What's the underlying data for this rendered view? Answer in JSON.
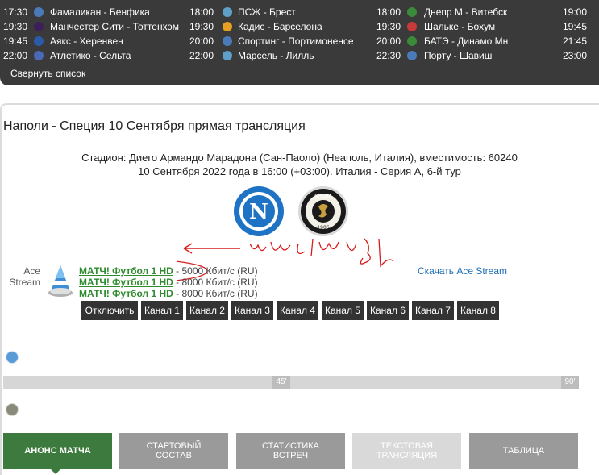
{
  "schedule": {
    "rows": [
      [
        {
          "time": "17:30",
          "teams": "Фамаликан - Бенфика",
          "icon": "portugal-league-icon",
          "color": "#4a7ab8"
        },
        {
          "time": "18:00",
          "teams": "ПСЖ - Брест",
          "icon": "france-league-icon",
          "color": "#5fa0c8"
        },
        {
          "time": "18:00",
          "teams": "Днепр М - Витебск",
          "icon": "belarus-league-icon",
          "color": "#3a8a3a"
        },
        {
          "time": "19:00",
          "teams": "",
          "icon": "",
          "color": ""
        }
      ],
      [
        {
          "time": "19:30",
          "teams": "Манчестер Сити - Тоттенхэм",
          "icon": "england-league-icon",
          "color": "#3d1f5a"
        },
        {
          "time": "19:30",
          "teams": "Кадис - Барселона",
          "icon": "spain-league-icon",
          "color": "#e8a020"
        },
        {
          "time": "19:30",
          "teams": "Шальке - Бохум",
          "icon": "germany-league-icon",
          "color": "#c83a3a"
        },
        {
          "time": "19:45",
          "teams": "",
          "icon": "",
          "color": ""
        }
      ],
      [
        {
          "time": "19:45",
          "teams": "Аякс - Херенвен",
          "icon": "netherlands-league-icon",
          "color": "#2a5aa8"
        },
        {
          "time": "20:00",
          "teams": "Спортинг - Портимоненсе",
          "icon": "portugal-league-icon",
          "color": "#4a7ab8"
        },
        {
          "time": "20:00",
          "teams": "БАТЭ - Динамо Мн",
          "icon": "belarus-league-icon",
          "color": "#3a8a3a"
        },
        {
          "time": "21:45",
          "teams": "",
          "icon": "",
          "color": ""
        }
      ],
      [
        {
          "time": "22:00",
          "teams": "Атлетико - Сельта",
          "icon": "spain-league-icon",
          "color": "#4a6ab8"
        },
        {
          "time": "22:00",
          "teams": "Марсель - Лилль",
          "icon": "france-league-icon",
          "color": "#5fa0c8"
        },
        {
          "time": "22:30",
          "teams": "Порту - Шавиш",
          "icon": "portugal-league-icon",
          "color": "#4a7ab8"
        },
        {
          "time": "23:00",
          "teams": "",
          "icon": "",
          "color": ""
        }
      ]
    ],
    "collapse_label": "Свернуть список"
  },
  "match": {
    "title_home": "Наполи",
    "title_sep": " - ",
    "title_rest": "Специя 10 Сентября прямая трансляция",
    "stadium": "Стадион: Диего Армандо Марадона (Сан-Паоло) (Неаполь, Италия), вместимость: 60240",
    "datetime": "10 Сентября 2022 года в 16:00 (+03:00). Италия - Серия А, 6-й тур",
    "home_logo_letter": "N",
    "away_logo_text": "SPEZIA",
    "away_logo_year": "1906"
  },
  "streams": {
    "ace_label_1": "Ace",
    "ace_label_2": "Stream",
    "download_label": "Скачать Ace Stream",
    "items": [
      {
        "name": "МАТЧ! Футбол 1 HD",
        "rate": " - 5000 Кбит/с (RU)"
      },
      {
        "name": "МАТЧ! Футбол 1 HD",
        "rate": " - 8000 Кбит/с (RU)"
      },
      {
        "name": "МАТЧ! Футбол 1 HD",
        "rate": " - 8000 Кбит/с (RU)"
      }
    ],
    "channels": [
      "Отключить",
      "Канал 1",
      "Канал 2",
      "Канал 3",
      "Канал 4",
      "Канал 5",
      "Канал 6",
      "Канал 7",
      "Канал 8"
    ]
  },
  "timeline": {
    "mark_45": "45'",
    "mark_90": "90'"
  },
  "tabs": [
    {
      "line1": "АНОНС МАТЧА",
      "line2": "",
      "color": "#3d7a3d"
    },
    {
      "line1": "СТАРТОВЫЙ",
      "line2": "СОСТАВ",
      "color": "#9a9a9a"
    },
    {
      "line1": "СТАТИСТИКА",
      "line2": "ВСТРЕЧ",
      "color": "#9a9a9a"
    },
    {
      "line1": "ТЕКСТОВАЯ",
      "line2": "ТРАНСЛЯЦИЯ",
      "color": "#d9d9d9"
    },
    {
      "line1": "ТАБЛИЦА",
      "line2": "",
      "color": "#9a9a9a"
    }
  ],
  "colors": {
    "schedule_bg": "#3a3a3a",
    "stream_link": "#2e8b2e",
    "annotation_red": "#d81b1b"
  }
}
